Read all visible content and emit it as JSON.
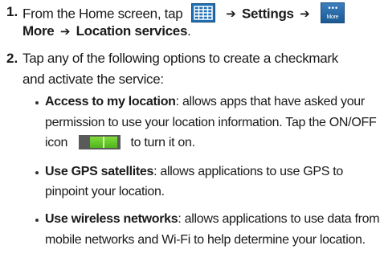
{
  "steps": [
    {
      "number": "1.",
      "line1_prefix": "From the Home screen, tap",
      "arrow1": "➔",
      "settings": "Settings",
      "arrow2": "➔",
      "line2_more": "More",
      "arrow3": "➔",
      "location_services": "Location services",
      "line2_end": "."
    },
    {
      "number": "2.",
      "line1": "Tap any of the following options to create a checkmark",
      "line2": "and activate the service:"
    }
  ],
  "bullets": [
    {
      "title": "Access to my location",
      "line1_rest": ": allows apps that have asked your",
      "line2": "permission to use your location information. Tap the ON/OFF",
      "line3_prefix": "icon",
      "line3_suffix": "to turn it on."
    },
    {
      "title": "Use GPS satellites",
      "line1_rest": ": allows applications to use GPS to",
      "line2": "pinpoint your location."
    },
    {
      "title": "Use wireless networks",
      "line1_rest": ": allows applications to use data from",
      "line2": "mobile networks and Wi-Fi to help determine your location."
    }
  ],
  "icons": {
    "apps": "apps-grid-icon",
    "more": "more-icon",
    "more_label": "More",
    "more_dots": "•••",
    "toggle": "on-off-toggle-icon"
  },
  "colors": {
    "apps_icon": "#1f6fb2",
    "more_icon": "#2a6aa8",
    "toggle_track": "#5a5a5a",
    "toggle_on": "#5fc424"
  }
}
